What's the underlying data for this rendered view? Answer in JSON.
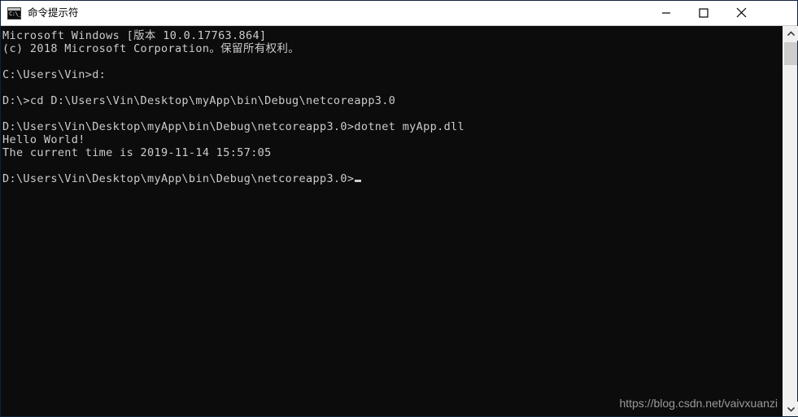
{
  "window": {
    "title": "命令提示符",
    "icon_name": "cmd-icon",
    "icon_glyph": "C:\\_",
    "controls": {
      "minimize_label": "最小化",
      "maximize_label": "最大化",
      "close_label": "关闭"
    }
  },
  "console": {
    "background_color": "#0c0c0c",
    "text_color": "#cccccc",
    "lines": [
      "Microsoft Windows [版本 10.0.17763.864]",
      "(c) 2018 Microsoft Corporation。保留所有权利。",
      "",
      "C:\\Users\\Vin>d:",
      "",
      "D:\\>cd D:\\Users\\Vin\\Desktop\\myApp\\bin\\Debug\\netcoreapp3.0",
      "",
      "D:\\Users\\Vin\\Desktop\\myApp\\bin\\Debug\\netcoreapp3.0>dotnet myApp.dll",
      "Hello World!",
      "The current time is 2019-11-14 15:57:05",
      ""
    ],
    "prompt": "D:\\Users\\Vin\\Desktop\\myApp\\bin\\Debug\\netcoreapp3.0>",
    "cursor": "_"
  },
  "watermark": {
    "text": "https://blog.csdn.net/vaivxuanzi"
  },
  "scrollbar": {
    "up_arrow": "▲",
    "down_arrow": "▼",
    "track_color": "#f0f0f0",
    "thumb_color": "#cdcdcd"
  }
}
